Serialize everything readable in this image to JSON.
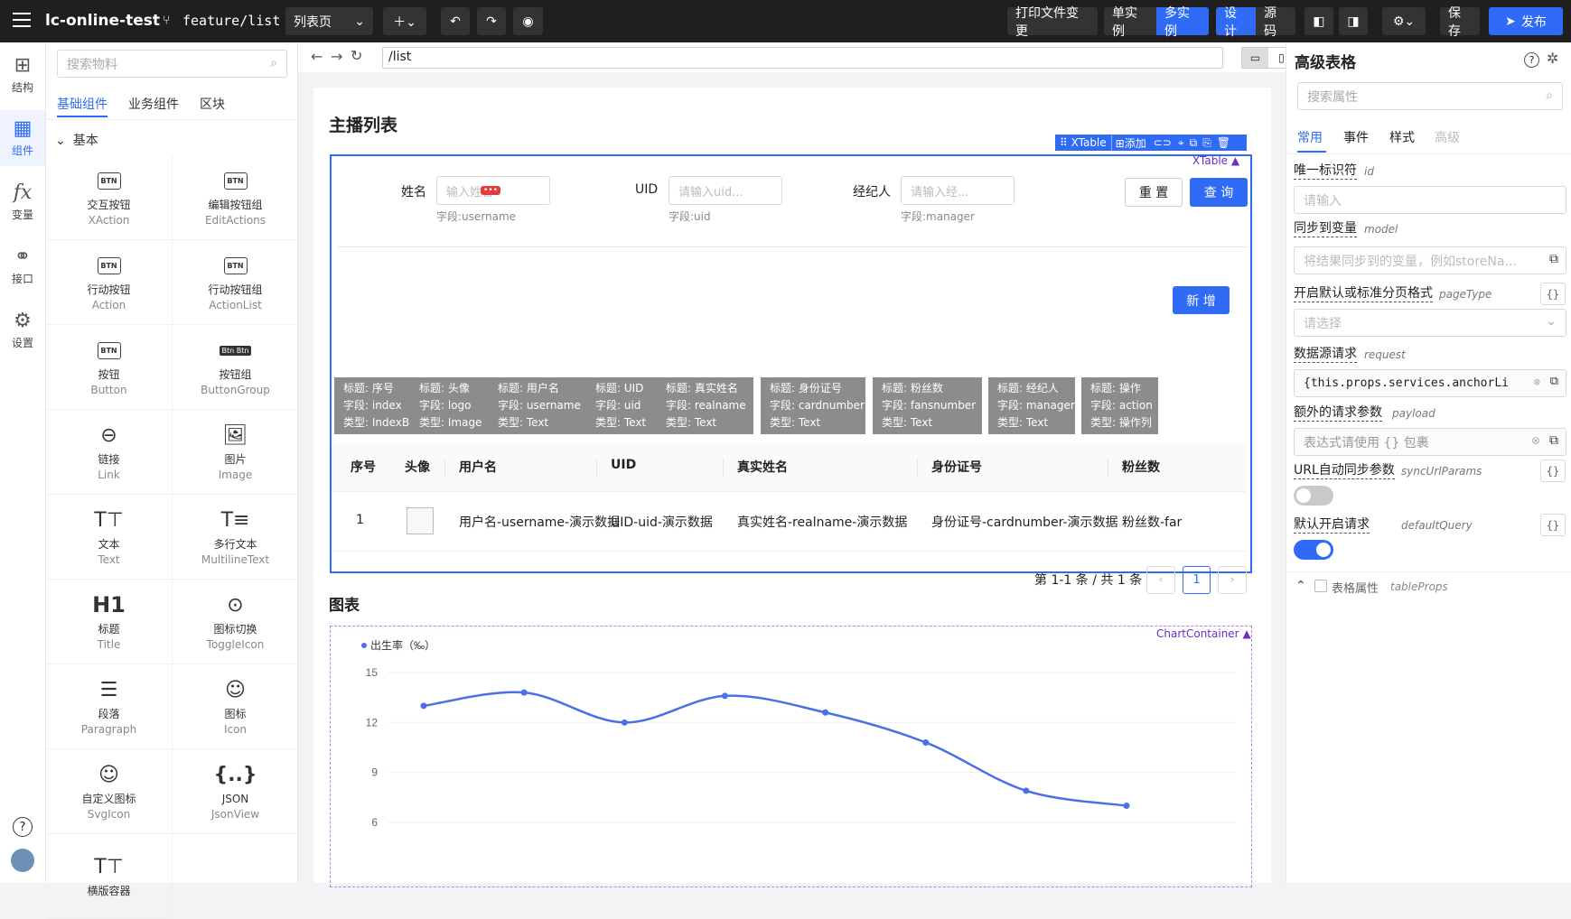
{
  "topbar": {
    "project": "lc-online-test",
    "branch": "feature/list",
    "page_select": "列表页",
    "print_btn": "打印文件变更",
    "single": "单实例",
    "multi": "多实例",
    "design": "设计",
    "source": "源码",
    "save": "保存",
    "publish": "发布"
  },
  "leftnav": [
    {
      "label": "结构",
      "icon": "structure-icon"
    },
    {
      "label": "组件",
      "icon": "components-icon"
    },
    {
      "label": "变量",
      "icon": "fx-icon"
    },
    {
      "label": "接口",
      "icon": "api-icon"
    },
    {
      "label": "设置",
      "icon": "settings-icon"
    }
  ],
  "palette": {
    "search_placeholder": "搜索物料",
    "tabs": [
      "基础组件",
      "业务组件",
      "区块"
    ],
    "group": "基本",
    "items": [
      {
        "name": "交互按钮",
        "en": "XAction",
        "icon": "btn-icon",
        "glyph": "BTN"
      },
      {
        "name": "编辑按钮组",
        "en": "EditActions",
        "icon": "btn-icon",
        "glyph": "BTN"
      },
      {
        "name": "行动按钮",
        "en": "Action",
        "icon": "btn-icon",
        "glyph": "BTN"
      },
      {
        "name": "行动按钮组",
        "en": "ActionList",
        "icon": "btn-icon",
        "glyph": "BTN"
      },
      {
        "name": "按钮",
        "en": "Button",
        "icon": "btn-icon",
        "glyph": "BTN"
      },
      {
        "name": "按钮组",
        "en": "ButtonGroup",
        "icon": "button-group-icon",
        "glyph": "Btn Btn"
      },
      {
        "name": "链接",
        "en": "Link",
        "icon": "link-icon",
        "glyph": "⊖"
      },
      {
        "name": "图片",
        "en": "Image",
        "icon": "image-icon",
        "glyph": "🖼"
      },
      {
        "name": "文本",
        "en": "Text",
        "icon": "text-icon",
        "glyph": "T⊤"
      },
      {
        "name": "多行文本",
        "en": "MultilineText",
        "icon": "multiline-text-icon",
        "glyph": "T≡"
      },
      {
        "name": "标题",
        "en": "Title",
        "icon": "h1-icon",
        "glyph": "H1"
      },
      {
        "name": "图标切换",
        "en": "ToggleIcon",
        "icon": "toggle-icon",
        "glyph": "⊙"
      },
      {
        "name": "段落",
        "en": "Paragraph",
        "icon": "paragraph-icon",
        "glyph": "☰"
      },
      {
        "name": "图标",
        "en": "Icon",
        "icon": "icon-icon",
        "glyph": "☺"
      },
      {
        "name": "自定义图标",
        "en": "SvgIcon",
        "icon": "svg-icon",
        "glyph": "☺"
      },
      {
        "name": "JSON",
        "en": "JsonView",
        "icon": "json-icon",
        "glyph": "{..}"
      },
      {
        "name": "横版容器",
        "en": "",
        "icon": "text-icon",
        "glyph": "T⊤"
      }
    ]
  },
  "canvas": {
    "url": "/list",
    "list_title": "主播列表",
    "xtable_tag": "XTable",
    "toolbar_xtable": "XTable",
    "toolbar_add": "添加",
    "search": [
      {
        "label": "姓名",
        "placeholder": "输入姓名",
        "hint": "字段:username"
      },
      {
        "label": "UID",
        "placeholder": "请输入uid...",
        "hint": "字段:uid"
      },
      {
        "label": "经纪人",
        "placeholder": "请输入经...",
        "hint": "字段:manager"
      }
    ],
    "reset": "重 置",
    "query": "查 询",
    "add_new": "新 增",
    "columns_meta": [
      {
        "t": "标题: 序号",
        "f": "字段: index",
        "ty": "类型: IndexBorder"
      },
      {
        "t": "标题: 头像",
        "f": "字段: logo",
        "ty": "类型: Image"
      },
      {
        "t": "标题: 用户名",
        "f": "字段: username",
        "ty": "类型: Text"
      },
      {
        "t": "标题: UID",
        "f": "字段: uid",
        "ty": "类型: Text"
      },
      {
        "t": "标题: 真实姓名",
        "f": "字段: realname",
        "ty": "类型: Text"
      },
      {
        "t": "标题: 身份证号",
        "f": "字段: cardnumber",
        "ty": "类型: Text"
      },
      {
        "t": "标题: 粉丝数",
        "f": "字段: fansnumber",
        "ty": "类型: Text"
      },
      {
        "t": "标题: 经纪人",
        "f": "字段: manager",
        "ty": "类型: Text"
      },
      {
        "t": "标题: 操作",
        "f": "字段: action",
        "ty": "类型: 操作列"
      }
    ],
    "headers": [
      "序号",
      "头像",
      "用户名",
      "UID",
      "真实姓名",
      "身份证号",
      "粉丝数"
    ],
    "row": [
      "1",
      "",
      "用户名-username-演示数据",
      "UID-uid-演示数据",
      "真实姓名-realname-演示数据",
      "身份证号-cardnumber-演示数据",
      "粉丝数-far"
    ],
    "pagination_text": "第 1-1 条 / 共 1 条",
    "page": "1",
    "chart_title": "图表",
    "chart_tag": "ChartContainer"
  },
  "chart_data": {
    "type": "line",
    "series": [
      {
        "name": "出生率（‰）",
        "values": [
          13,
          13.8,
          12,
          13.6,
          12.6,
          10.8,
          7.9,
          7
        ]
      }
    ],
    "x": [
      1,
      2,
      3,
      4,
      5,
      6,
      7,
      8
    ],
    "ylim": [
      6,
      15
    ],
    "yticks": [
      "15",
      "12",
      "9",
      "6"
    ],
    "color": "#4a6fe8"
  },
  "right": {
    "title": "高级表格",
    "search_placeholder": "搜索属性",
    "tabs": [
      "常用",
      "事件",
      "样式",
      "高级"
    ],
    "props": [
      {
        "label": "唯一标识符",
        "en": "id",
        "value": "请输入"
      },
      {
        "label": "同步到变量",
        "en": "model",
        "value": "将结果同步到的变量，例如storeNa..."
      },
      {
        "label": "开启默认或标准分页格式",
        "en": "pageType",
        "value": "请选择"
      },
      {
        "label": "数据源请求",
        "en": "request",
        "value": "{this.props.services.anchorLi"
      },
      {
        "label": "额外的请求参数",
        "en": "payload",
        "value": "表达式请使用 {} 包裹"
      },
      {
        "label": "URL自动同步参数",
        "en": "syncUrlParams"
      },
      {
        "label": "默认开启请求",
        "en": "defaultQuery"
      }
    ],
    "table_props": "表格属性",
    "table_props_en": "tableProps",
    "braces": "{}"
  },
  "colors": {
    "primary": "#2f6bf5",
    "dark": "#1f1f1f"
  }
}
